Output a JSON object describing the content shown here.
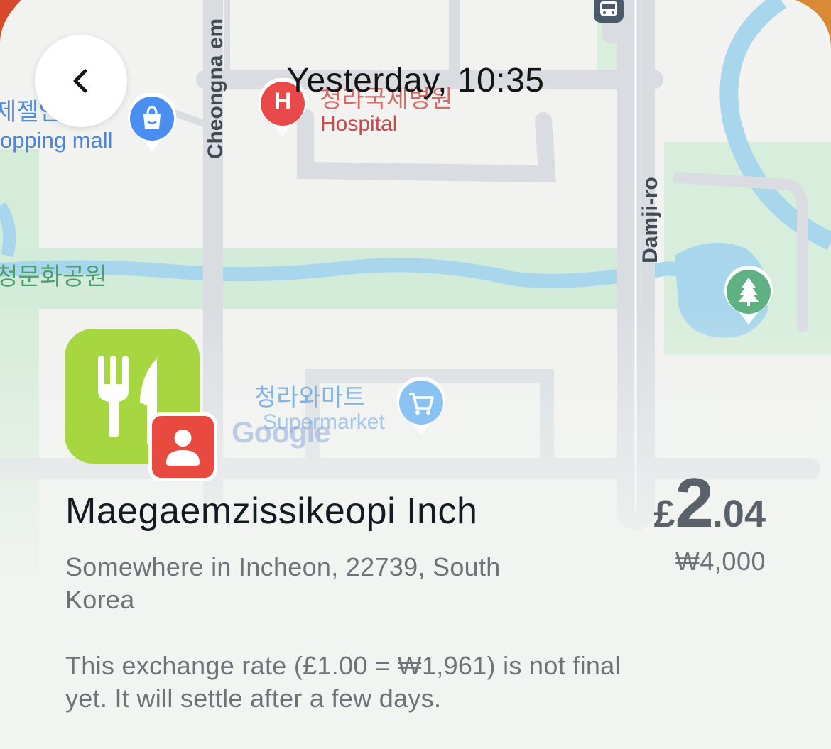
{
  "header": {
    "back_icon": "chevron-left-icon",
    "title": "Yesterday, 10:35"
  },
  "map": {
    "labels": {
      "mall_korean": "제젤인",
      "mall_english": "opping mall",
      "hospital_korean": "청라국제병원",
      "hospital_english": "Hospital",
      "street_cheongna": "Cheongna em",
      "street_damji": "Damji-ro",
      "park_korean": "청문화공원",
      "supermarket_korean": "청라와마트",
      "supermarket_english": "Supermarket",
      "google": "Google"
    },
    "icons": {
      "bus": "bus-icon",
      "shopping": "shopping-bag-icon",
      "hospital": "hospital-icon",
      "park": "tree-icon",
      "supermarket": "cart-icon"
    },
    "pin_letters": {
      "hospital": "H"
    },
    "colors": {
      "land": "#f2f3f1",
      "road": "#d6dbe0",
      "water": "#a8d6ec",
      "park": "#cdebd4",
      "hospital_pin": "#e74a49",
      "shopping_pin": "#4a8ff0",
      "park_pin": "#5fb183",
      "supermarket_pin": "#79bbf2"
    }
  },
  "transaction": {
    "category_icon": "fork-knife-icon",
    "badge_icon": "person-icon",
    "merchant_name": "Maegaemzissikeopi Inch",
    "address": "Somewhere in Incheon, 22739, South Korea",
    "amount_symbol": "£",
    "amount_major": "2",
    "amount_minor": ".04",
    "local_amount": "₩4,000",
    "exchange_note": "This exchange rate (£1.00 = ₩1,961) is not final yet. It will settle after a few days.",
    "colors": {
      "category_bg": "#a6d640",
      "badge_bg": "#e94a3f",
      "amount_text": "#5b616a"
    }
  }
}
